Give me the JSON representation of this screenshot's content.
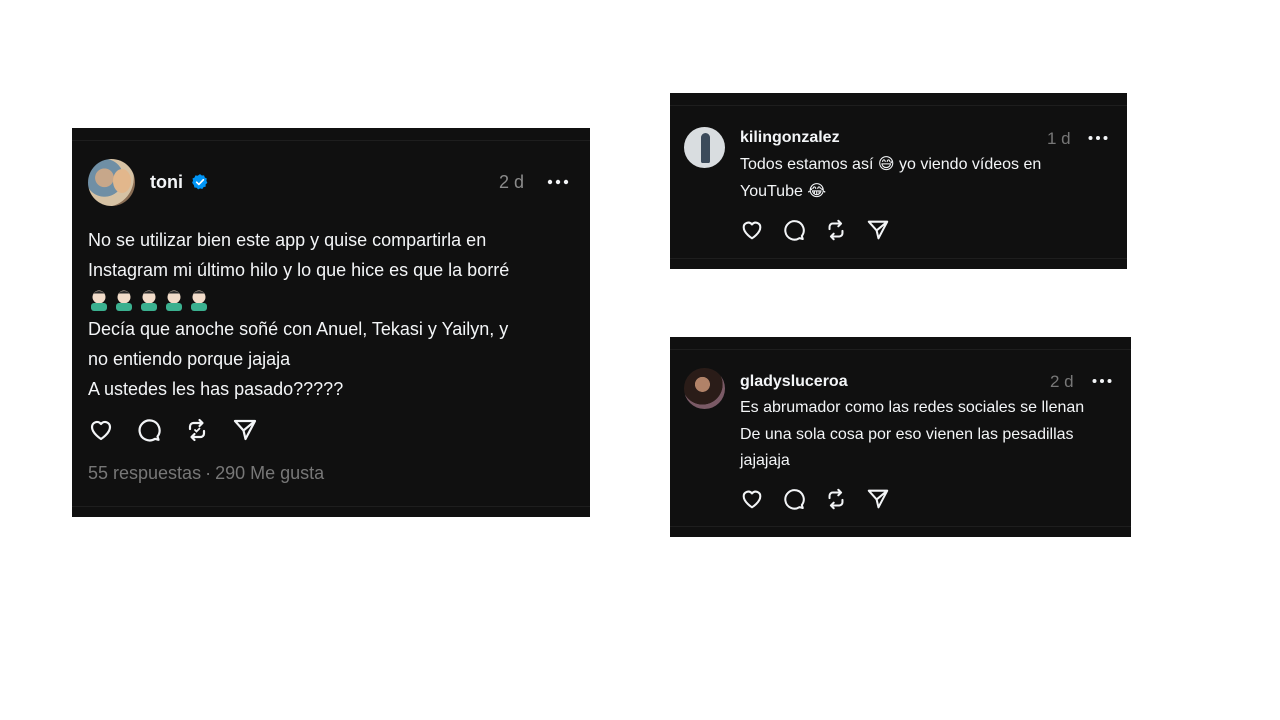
{
  "post": {
    "username": "toni",
    "time": "2 d",
    "lines": [
      "No se utilizar bien este app y quise compartirla en",
      "Instagram mi último hilo y lo que hice es que la borré"
    ],
    "emoji_row": "🤦🏻‍♂️🤦🏻‍♂️🤦🏻‍♂️🤦🏻‍♂️🤦🏻‍♂️",
    "lines2": [
      "Decía que anoche soñé con Anuel, Tekasi y Yailyn, y",
      "no entiendo porque jajaja",
      "A ustedes les has pasado?????"
    ],
    "replies_count": "55 respuestas",
    "separator": "·",
    "likes_count": "290 Me gusta"
  },
  "replies": [
    {
      "username": "kilingonzalez",
      "time": "1 d",
      "lines": [
        "Todos estamos así 😅 yo viendo vídeos en",
        "YouTube 😂"
      ]
    },
    {
      "username": "gladysluceroa",
      "time": "2 d",
      "lines": [
        "Es abrumador como las redes sociales se llenan",
        "De una sola cosa por eso vienen las pesadillas",
        "jajajaja"
      ]
    }
  ],
  "icons": {
    "like": "heart-icon",
    "comment": "comment-icon",
    "repost": "repost-icon",
    "share": "send-icon",
    "more": "more-icon",
    "verified": "verified-badge-icon"
  },
  "colors": {
    "card_bg": "#101010",
    "text": "#f3f5f7",
    "muted": "#777777",
    "verified": "#0095f6"
  }
}
